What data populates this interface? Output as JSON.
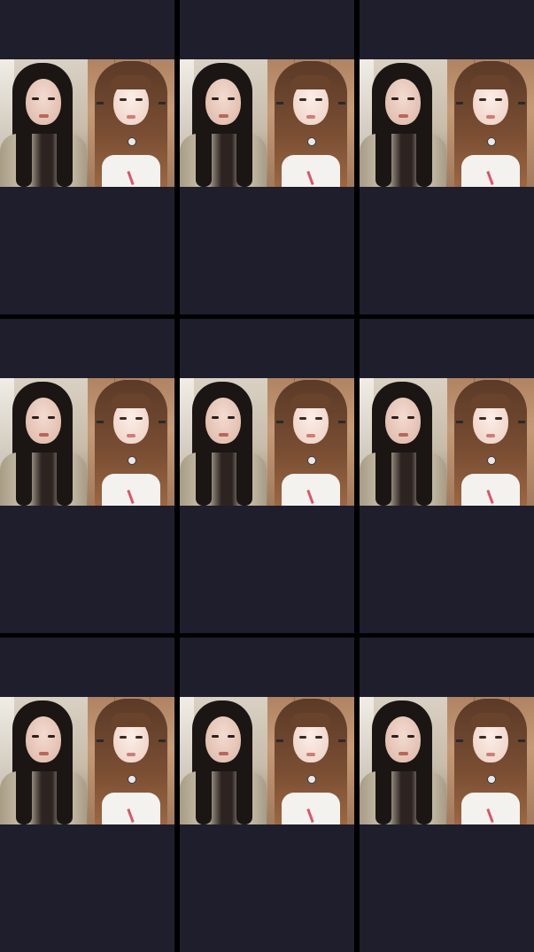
{
  "screen": {
    "background": "#000000",
    "tile_background": "#1f1e2c"
  },
  "tiles": [
    {
      "left_stream": "streamer-long-dark-hair",
      "right_stream": "streamer-brown-hair"
    },
    {
      "left_stream": "streamer-long-dark-hair",
      "right_stream": "streamer-brown-hair"
    },
    {
      "left_stream": "streamer-long-dark-hair",
      "right_stream": "streamer-brown-hair"
    },
    {
      "left_stream": "streamer-long-dark-hair",
      "right_stream": "streamer-brown-hair"
    },
    {
      "left_stream": "streamer-long-dark-hair",
      "right_stream": "streamer-brown-hair"
    },
    {
      "left_stream": "streamer-long-dark-hair",
      "right_stream": "streamer-brown-hair"
    },
    {
      "left_stream": "streamer-long-dark-hair",
      "right_stream": "streamer-brown-hair"
    },
    {
      "left_stream": "streamer-long-dark-hair",
      "right_stream": "streamer-brown-hair"
    },
    {
      "left_stream": "streamer-long-dark-hair",
      "right_stream": "streamer-brown-hair"
    }
  ]
}
